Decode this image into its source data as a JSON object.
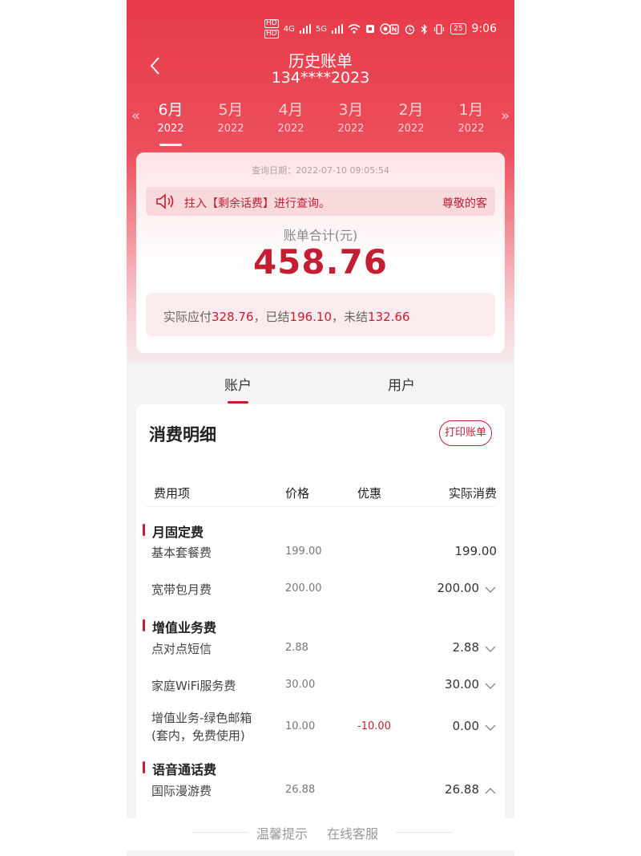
{
  "status": {
    "time": "9:06",
    "battery": "25",
    "hd1": "HD",
    "hd2": "HD",
    "net1": "4G",
    "net2": "5G"
  },
  "header": {
    "title": "历史账单",
    "phone": "134****2023"
  },
  "months": [
    {
      "month": "6月",
      "year": "2022",
      "active": true
    },
    {
      "month": "5月",
      "year": "2022"
    },
    {
      "month": "4月",
      "year": "2022"
    },
    {
      "month": "3月",
      "year": "2022"
    },
    {
      "month": "2月",
      "year": "2022"
    },
    {
      "month": "1月",
      "year": "2022"
    }
  ],
  "bill": {
    "query_date": "查询日期：2022-07-10 09:05:54",
    "notice_text": "拄入【剩余话费】进行查询。",
    "notice_right": "尊敬的客",
    "total_label": "账单合计(元)",
    "total_amount": "458.76",
    "summary": {
      "due_label": "实际应付",
      "due_value": "328.76",
      "paid_label": "，已结",
      "paid_value": "196.10",
      "unpaid_label": "，未结",
      "unpaid_value": "132.66"
    }
  },
  "tabs": {
    "account": "账户",
    "user": "用户"
  },
  "detail": {
    "title": "消费明细",
    "print_label": "打印账单",
    "headers": {
      "name": "费用项",
      "price": "价格",
      "discount": "优惠",
      "actual": "实际消费"
    },
    "sections": [
      {
        "name": "月固定费"
      },
      {
        "name": "增值业务费"
      },
      {
        "name": "语音通话费"
      }
    ],
    "rows": [
      {
        "name": "基本套餐费",
        "price": "199.00",
        "discount": "",
        "actual": "199.00"
      },
      {
        "name": "宽带包月费",
        "price": "200.00",
        "discount": "",
        "actual": "200.00"
      },
      {
        "name": "点对点短信",
        "price": "2.88",
        "discount": "",
        "actual": "2.88"
      },
      {
        "name": "家庭WiFi服务费",
        "price": "30.00",
        "discount": "",
        "actual": "30.00"
      },
      {
        "name": "增值业务-绿色邮箱",
        "name2": "(套内，免费使用)",
        "price": "10.00",
        "discount": "-10.00",
        "actual": "0.00"
      },
      {
        "name": "国际漫游费",
        "price": "26.88",
        "discount": "",
        "actual": "26.88"
      }
    ]
  },
  "footer": {
    "tips": "温馨提示",
    "service": "在线客服"
  }
}
